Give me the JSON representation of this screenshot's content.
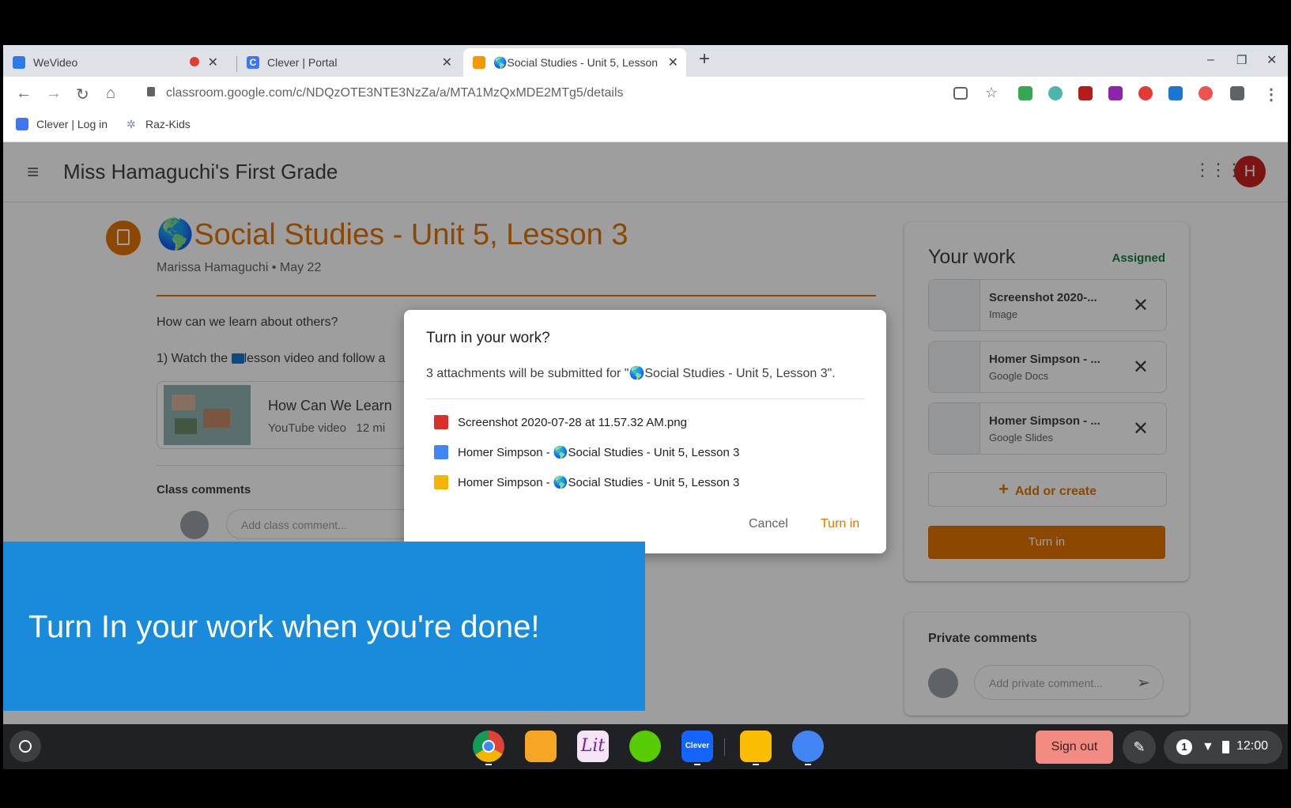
{
  "browser": {
    "tabs": [
      {
        "title": "WeVideo",
        "recording": true
      },
      {
        "title": "Clever | Portal"
      },
      {
        "title": "🌎Social Studies - Unit 5, Lesson 3"
      }
    ],
    "new_tab": "+",
    "window_controls": [
      "–",
      "❐",
      "✕"
    ],
    "url": "classroom.google.com/c/NDQzOTE3NTE3NzZa/a/MTA1MzQxMDE2MTg5/details",
    "bookmarks": [
      {
        "label": "Clever | Log in"
      },
      {
        "label": "Raz-Kids"
      }
    ]
  },
  "classroom": {
    "class_name": "Miss Hamaguchi's First Grade",
    "avatar_letter": "H",
    "assignment": {
      "title": "🌎Social Studies - Unit 5, Lesson 3",
      "meta": "Marissa Hamaguchi • May 22",
      "question": "How can we learn about others?",
      "step1_pre": "1) Watch the ",
      "step1_post": "lesson video and follow a",
      "video_title": "How Can We Learn",
      "video_sub": "YouTube video   12 mi",
      "class_comments": "Class comments",
      "add_class_comment": "Add class comment..."
    },
    "your_work": {
      "title": "Your work",
      "status": "Assigned",
      "attachments": [
        {
          "name": "Screenshot 2020-...",
          "type": "Image"
        },
        {
          "name": "Homer Simpson - ...",
          "type": "Google Docs"
        },
        {
          "name": "Homer Simpson - ...",
          "type": "Google Slides"
        }
      ],
      "add_or_create": "Add or create",
      "turn_in": "Turn in"
    },
    "private_comments": {
      "title": "Private comments",
      "placeholder": "Add private comment..."
    }
  },
  "dialog": {
    "title": "Turn in your work?",
    "message": "3 attachments will be submitted for \"🌎Social Studies - Unit 5, Lesson 3\".",
    "files": [
      {
        "name": "Screenshot 2020-07-28 at 11.57.32 AM.png",
        "icon": "image-icon",
        "color": "#d93025"
      },
      {
        "name": "Homer Simpson - 🌎Social Studies - Unit 5, Lesson 3",
        "icon": "docs-icon",
        "color": "#4285f4"
      },
      {
        "name": "Homer Simpson - 🌎Social Studies - Unit 5, Lesson 3",
        "icon": "slides-icon",
        "color": "#f4b400"
      }
    ],
    "cancel": "Cancel",
    "confirm": "Turn in"
  },
  "banner": {
    "text": "Turn In your work when you're done!",
    "color": "#1a8bdb"
  },
  "taskbar": {
    "sign_out": "Sign out",
    "notification_count": "1",
    "time": "12:00",
    "apps": [
      "chrome-icon",
      "owl-app-icon",
      "lit-app-icon",
      "duolingo-icon",
      "clever-icon",
      "keep-icon",
      "files-icon"
    ],
    "clever_label": "Clever"
  },
  "colors": {
    "accent": "#e37400",
    "turn_in_button": "#e37400"
  }
}
